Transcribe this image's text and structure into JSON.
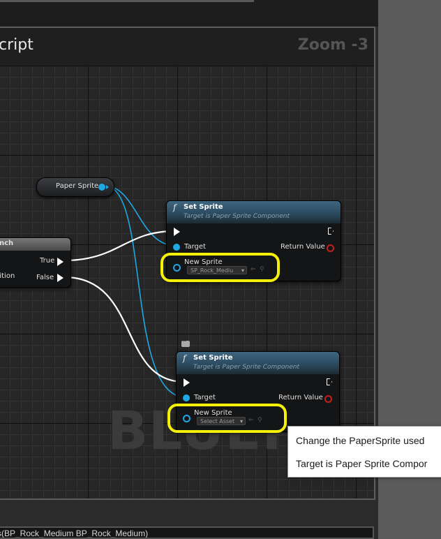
{
  "graph": {
    "title": "cript",
    "zoom": "Zoom -3",
    "watermark": "BLUEPR"
  },
  "variable_node": {
    "label": "Paper Sprite"
  },
  "branch_node": {
    "title": "nch",
    "true_label": "True",
    "condition_label": "dition",
    "false_label": "False"
  },
  "set_sprite_nodes": [
    {
      "title": "Set Sprite",
      "subtitle": "Target is Paper Sprite Component",
      "target_label": "Target",
      "return_label": "Return Value",
      "new_sprite_label": "New Sprite",
      "asset_value": "SP_Rock_Mediu"
    },
    {
      "title": "Set Sprite",
      "subtitle": "Target is Paper Sprite Component",
      "target_label": "Target",
      "return_label": "Return Value",
      "new_sprite_label": "New Sprite",
      "asset_value": "Select Asset"
    }
  ],
  "icons": {
    "function": "f",
    "dropdown": "▾",
    "use_selected": "⇐",
    "browse": "⚲"
  },
  "tooltip": {
    "line1": "Change the PaperSprite used",
    "line2": "Target is Paper Sprite Compor"
  },
  "bottom_bar": {
    "text": "s(BP_Rock_Medium BP_Rock_Medium)"
  },
  "colors": {
    "highlight": "#f4f00a",
    "object_pin": "#1fa8e4",
    "return_pin": "#c31f1f",
    "exec_wire": "#ffffff"
  }
}
